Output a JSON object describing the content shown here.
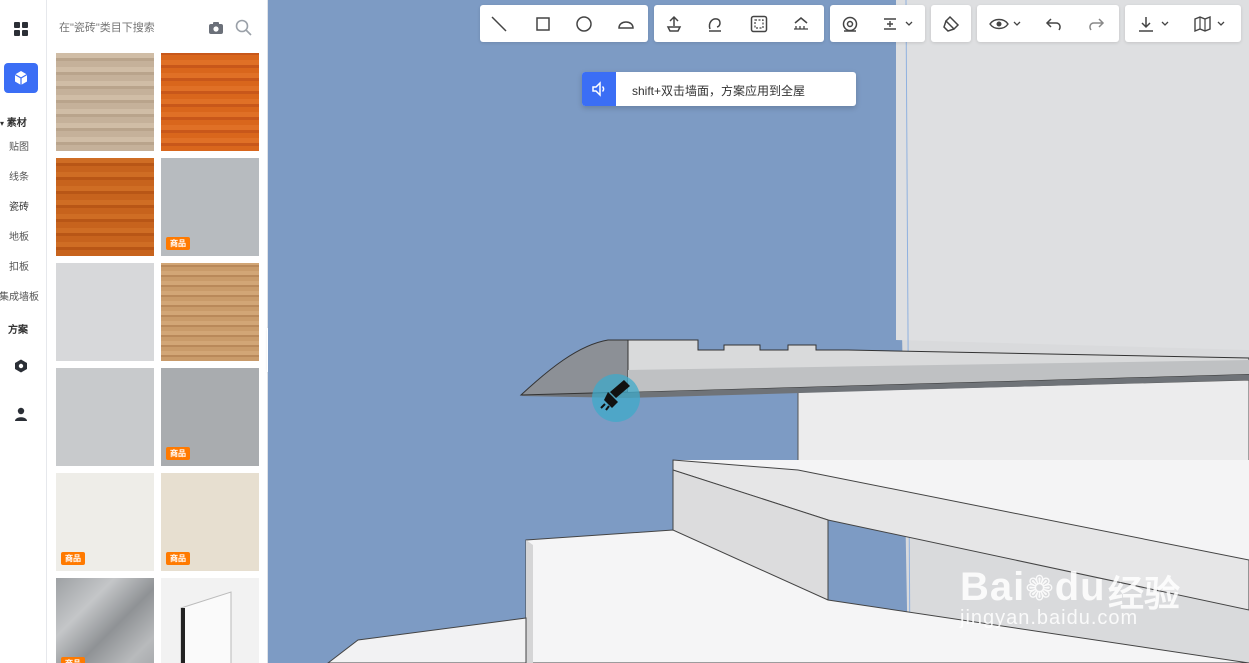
{
  "sidebar": {
    "category_header": "素材",
    "items": [
      "贴图",
      "线条",
      "瓷砖",
      "地板",
      "扣板",
      "集成墙板"
    ],
    "scheme_label": "方案"
  },
  "panel": {
    "search_placeholder": "在\"瓷砖\"类目下搜索",
    "badge_label": "商品",
    "thumbnails": [
      {
        "name": "light-wood-texture",
        "badge": false
      },
      {
        "name": "orange-wood-texture",
        "badge": false
      },
      {
        "name": "cherry-wood-texture",
        "badge": false
      },
      {
        "name": "gray-texture",
        "badge": true
      },
      {
        "name": "light-gray-texture",
        "badge": false
      },
      {
        "name": "oak-texture",
        "badge": false
      },
      {
        "name": "silver-gray-texture",
        "badge": false
      },
      {
        "name": "medium-gray-texture",
        "badge": true
      },
      {
        "name": "off-white-texture",
        "badge": true
      },
      {
        "name": "beige-texture",
        "badge": true
      },
      {
        "name": "gray-marble-texture",
        "badge": true
      },
      {
        "name": "skirting-board-model",
        "badge": false
      }
    ]
  },
  "toolbar": {
    "groups": [
      [
        "line-icon",
        "rectangle-icon",
        "circle-icon",
        "arc-icon"
      ],
      [
        "push-pull-icon",
        "rotate-icon",
        "offset-icon",
        "roof-icon"
      ],
      [
        "measure-icon",
        "align-dropdown-icon"
      ],
      [
        "paint-brush-icon"
      ],
      [
        "view-dropdown-icon",
        "undo-icon",
        "redo-icon"
      ],
      [
        "download-dropdown-icon",
        "map-dropdown-icon"
      ]
    ]
  },
  "tip": {
    "text": "shift+双击墙面，方案应用到全屋"
  },
  "watermark": {
    "brand": "Bai",
    "brand2": "du",
    "cn": "经验",
    "url": "jingyan.baidu.com"
  },
  "colors": {
    "accent": "#3b6ef5",
    "badge": "#ff7a00",
    "wall_blue": "#7d9bc4",
    "cursor_highlight": "#3fa9c9"
  }
}
